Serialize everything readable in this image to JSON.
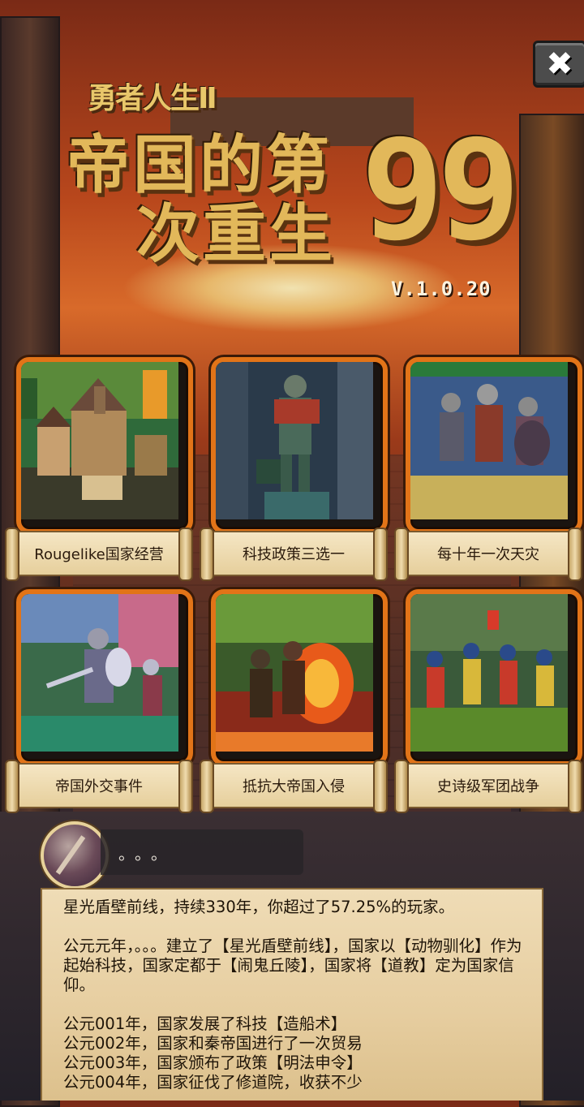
{
  "title": {
    "subtitle": "勇者人生Ⅱ",
    "line1": "帝国的第",
    "line2": "次重生",
    "number": "99",
    "version": "V.1.0.20"
  },
  "close_button": {
    "icon": "close-icon",
    "glyph": "✖"
  },
  "features": [
    {
      "label": "Rougelike国家经营",
      "art": "medieval-town-icon"
    },
    {
      "label": "科技政策三选一",
      "art": "knight-statue-icon"
    },
    {
      "label": "每十年一次天灾",
      "art": "soldiers-charge-icon"
    },
    {
      "label": "帝国外交事件",
      "art": "knight-duel-icon"
    },
    {
      "label": "抵抗大帝国入侵",
      "art": "burning-battle-icon"
    },
    {
      "label": "史诗级军团战争",
      "art": "army-march-icon"
    }
  ],
  "chat": {
    "text": "。。。"
  },
  "log": {
    "summary": "星光盾壁前线，持续330年，你超过了57.25%的玩家。",
    "founding": "公元元年，。。。建立了【星光盾壁前线】，国家以【动物驯化】作为起始科技，国家定都于【闹鬼丘陵】，国家将【道教】定为国家信仰。",
    "entries": [
      "公元001年，国家发展了科技【造船术】",
      "公元002年，国家和秦帝国进行了一次贸易",
      "公元003年，国家颁布了政策【明法申令】",
      "公元004年，国家征伐了修道院，收获不少"
    ]
  },
  "colors": {
    "frame": "#e27418",
    "gold": "#e2b85a",
    "parchment": "#efdcb6"
  }
}
